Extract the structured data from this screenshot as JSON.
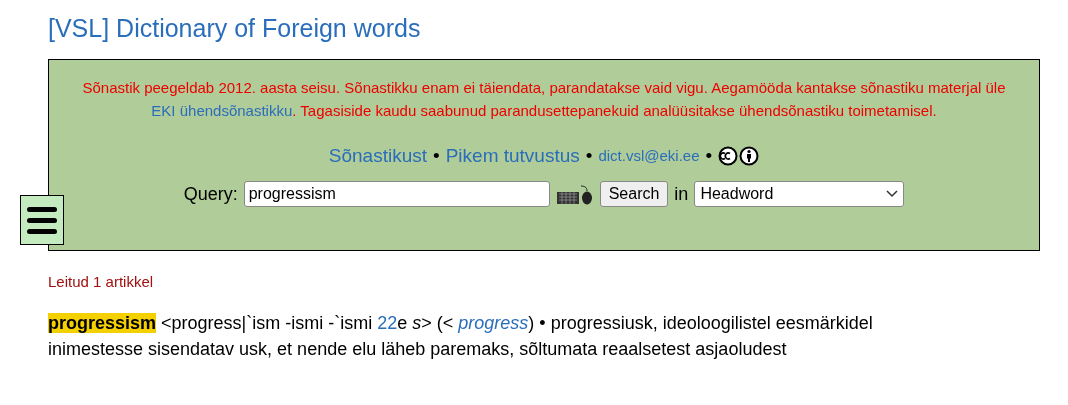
{
  "title": "[VSL] Dictionary of Foreign words",
  "notice": [
    {
      "kind": "text",
      "text": "Sõnastik peegeldab 2012. aasta seisu. Sõnastikku enam ei täiendata, parandatakse vaid vigu. Aegamööda kantakse sõnastiku materjal üle "
    },
    {
      "kind": "link",
      "text": "EKI ühendsõnastikku"
    },
    {
      "kind": "text",
      "text": ". Tagasiside kaudu saabunud parandusettepanekuid analüüsitakse ühendsõnastiku toimetamisel."
    }
  ],
  "links": [
    {
      "kind": "link",
      "text": "Sõnastikust"
    },
    {
      "kind": "sep",
      "text": "•"
    },
    {
      "kind": "link",
      "text": "Pikem tutvustus"
    },
    {
      "kind": "sep",
      "text": "•"
    },
    {
      "kind": "email",
      "text": "dict.vsl@eki.ee"
    },
    {
      "kind": "sep",
      "text": "•"
    },
    {
      "kind": "license"
    }
  ],
  "query": {
    "label": "Query:",
    "value": "progressism",
    "button": "Search",
    "in_label": "in",
    "field": "Headword"
  },
  "result_count": "Leitud 1 artikkel",
  "entry": [
    {
      "kind": "headword",
      "text": "progressism"
    },
    {
      "kind": "text",
      "text": " <progress|`ism -ismi -`ismi "
    },
    {
      "kind": "link",
      "text": "22"
    },
    {
      "kind": "text",
      "text": "e *s*> (< "
    },
    {
      "kind": "italic-link",
      "text": "progress"
    },
    {
      "kind": "text",
      "text": ") • progressiusk, ideoloogilistel eesmärkidel inimestesse sisendatav usk, et nende elu läheb paremaks, sõltumata reaalsetest asjaoludest"
    }
  ]
}
